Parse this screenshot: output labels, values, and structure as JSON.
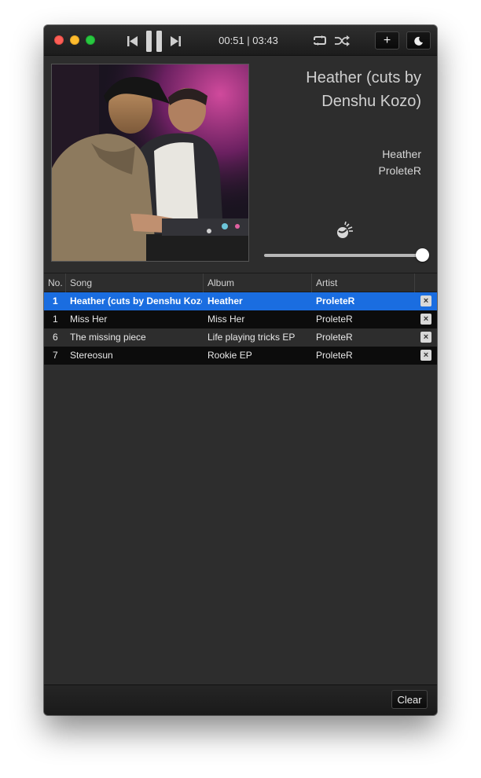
{
  "player": {
    "elapsed": "00:51",
    "duration": "03:43",
    "time_display": "00:51 | 03:43",
    "add_label": "+",
    "volume_level": 1.0
  },
  "now_playing": {
    "title": "Heather (cuts by Denshu Kozo)",
    "album": "Heather",
    "artist": "ProleteR"
  },
  "playlist": {
    "columns": [
      "No.",
      "Song",
      "Album",
      "Artist"
    ],
    "rows": [
      {
        "no": "1",
        "song": "Heather (cuts by Denshu Kozo)",
        "album": "Heather",
        "artist": "ProleteR",
        "selected": true
      },
      {
        "no": "1",
        "song": "Miss Her",
        "album": "Miss Her",
        "artist": "ProleteR",
        "selected": false
      },
      {
        "no": "6",
        "song": "The missing piece",
        "album": "Life playing tricks EP",
        "artist": "ProleteR",
        "selected": false
      },
      {
        "no": "7",
        "song": "Stereosun",
        "album": "Rookie EP",
        "artist": "ProleteR",
        "selected": false
      }
    ],
    "remove_label": "×"
  },
  "footer": {
    "clear_label": "Clear"
  },
  "icons": {
    "previous": "previous-icon",
    "pause": "pause-icon",
    "next": "next-icon",
    "repeat": "repeat-icon",
    "shuffle": "shuffle-icon",
    "add": "plus-icon",
    "night": "moon-icon",
    "volume": "volume-icon",
    "remove": "close-icon"
  },
  "colors": {
    "selection": "#1a6de0",
    "window_bg": "#2d2d2d",
    "row_dark": "#0c0c0c",
    "close": "#fd5f57",
    "minimize": "#febc2e",
    "maximize": "#28c840"
  }
}
